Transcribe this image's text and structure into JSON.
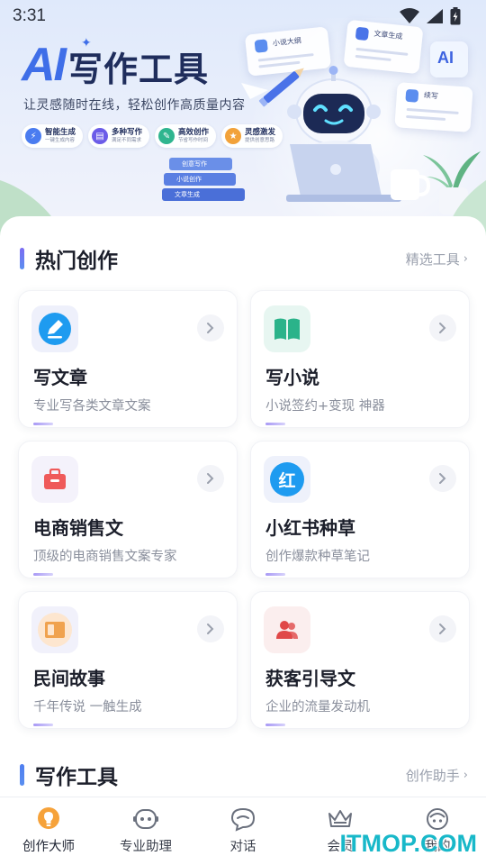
{
  "status_bar": {
    "time": "3:31"
  },
  "banner": {
    "logo_text": "AI",
    "title": "写作工具",
    "subtitle": "让灵感随时在线，轻松创作高质量内容",
    "chips": [
      {
        "title": "智能生成",
        "sub": "一键生成内容",
        "color": "#4a7cf0"
      },
      {
        "title": "多种写作",
        "sub": "满足不同需求",
        "color": "#6b5ce8"
      },
      {
        "title": "高效创作",
        "sub": "节省写作时间",
        "color": "#2fb58f"
      },
      {
        "title": "灵感激发",
        "sub": "提供创意思路",
        "color": "#f2a23a"
      }
    ],
    "books": [
      "创意写作",
      "小说创作",
      "文章生成"
    ],
    "float_cards": [
      "小说大纲",
      "文章生成",
      "AI",
      "续写"
    ]
  },
  "hot_section": {
    "title": "热门创作",
    "link_label": "精选工具",
    "cards": [
      {
        "title": "写文章",
        "desc": "专业写各类文章文案",
        "icon": "pen-icon",
        "icon_bg": "#eef0fb",
        "icon_color": "#1e9bf0"
      },
      {
        "title": "写小说",
        "desc": "小说签约+变现 神器",
        "icon": "book-icon",
        "icon_bg": "#e7f6f1",
        "icon_color": "#2bb38a"
      },
      {
        "title": "电商销售文",
        "desc": "顶级的电商销售文案专家",
        "icon": "shop-bag-icon",
        "icon_bg": "#f4f2fb",
        "icon_color": "#ef5a5a"
      },
      {
        "title": "小红书种草",
        "desc": "创作爆款种草笔记",
        "icon": "red-badge-icon",
        "icon_bg": "#eef1fb",
        "icon_color": "#1e9bf0",
        "icon_text": "红"
      },
      {
        "title": "民间故事",
        "desc": "千年传说 一触生成",
        "icon": "story-book-icon",
        "icon_bg": "#f1f1fb",
        "icon_color": "#f0a24e"
      },
      {
        "title": "获客引导文",
        "desc": "企业的流量发动机",
        "icon": "users-icon",
        "icon_bg": "#fbeeee",
        "icon_color": "#e04848"
      }
    ]
  },
  "tools_section": {
    "title": "写作工具",
    "link_label": "创作助手"
  },
  "bottom_nav": [
    {
      "label": "创作大师",
      "icon": "lightbulb-icon",
      "active": true
    },
    {
      "label": "专业助理",
      "icon": "robot-face-icon",
      "active": false
    },
    {
      "label": "对话",
      "icon": "chat-bubble-icon",
      "active": false
    },
    {
      "label": "会员",
      "icon": "crown-icon",
      "active": false
    },
    {
      "label": "我的",
      "icon": "profile-icon",
      "active": false
    }
  ],
  "watermark": "ITMOP.COM"
}
